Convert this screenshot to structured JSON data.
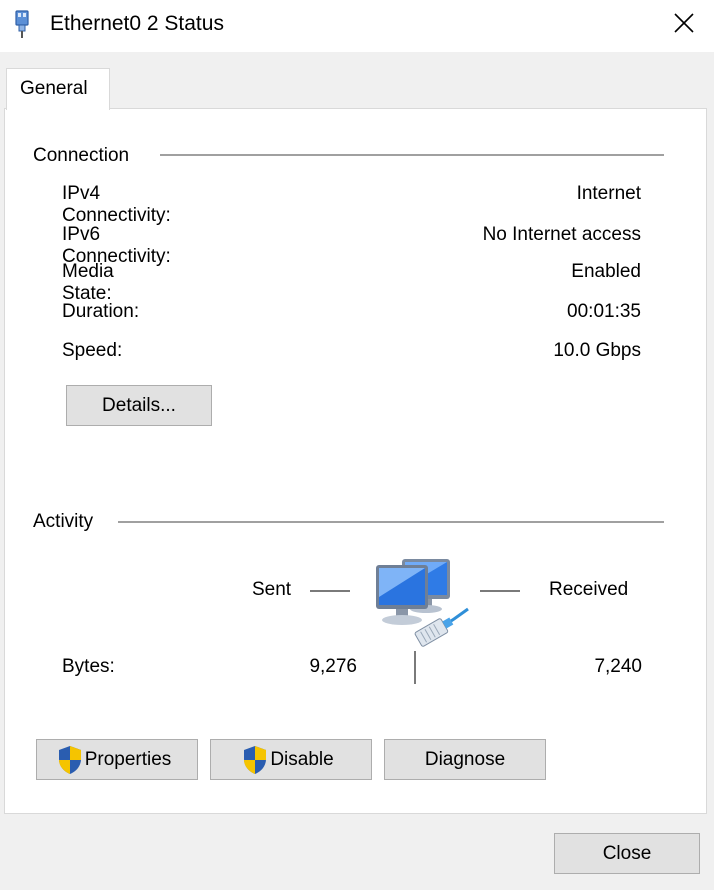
{
  "window": {
    "title": "Ethernet0 2 Status",
    "icon": "network-adapter-icon",
    "close_icon": "close-icon"
  },
  "tabs": [
    {
      "label": "General",
      "selected": true
    }
  ],
  "connection": {
    "label": "Connection",
    "rows": [
      {
        "label": "IPv4 Connectivity:",
        "value": "Internet"
      },
      {
        "label": "IPv6 Connectivity:",
        "value": "No Internet access"
      },
      {
        "label": "Media State:",
        "value": "Enabled"
      },
      {
        "label": "Duration:",
        "value": "00:01:35"
      },
      {
        "label": "Speed:",
        "value": "10.0 Gbps"
      }
    ],
    "details_button": "Details..."
  },
  "activity": {
    "label": "Activity",
    "sent_label": "Sent",
    "received_label": "Received",
    "bytes_label": "Bytes:",
    "bytes_sent": "9,276",
    "bytes_received": "7,240",
    "icon": "network-computers-icon"
  },
  "buttons": {
    "properties": "Properties",
    "disable": "Disable",
    "diagnose": "Diagnose",
    "close": "Close"
  },
  "colors": {
    "window_bg": "#f0f0f0",
    "panel_bg": "#ffffff",
    "button_bg": "#e1e1e1",
    "button_border": "#adadad",
    "shield_blue": "#2a5db0",
    "shield_yellow": "#f5c400"
  }
}
